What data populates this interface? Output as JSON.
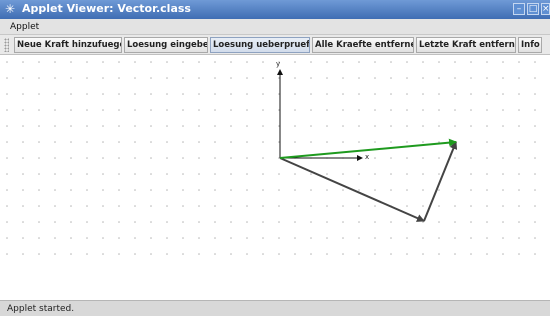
{
  "window": {
    "title": "Applet Viewer: Vector.class",
    "buttons": [
      "minimize-icon",
      "maximize-icon",
      "close-icon"
    ]
  },
  "menubar": {
    "items": [
      {
        "label": "Applet"
      }
    ]
  },
  "toolbar": {
    "buttons": [
      {
        "label": "Neue Kraft hinzufuegen"
      },
      {
        "label": "Loesung eingeben"
      },
      {
        "label": "Loesung ueberpruefen",
        "active": true
      },
      {
        "label": "Alle Kraefte entfernen"
      },
      {
        "label": "Letzte Kraft entfernen"
      },
      {
        "label": "Info"
      }
    ]
  },
  "canvas": {
    "x_axis_label": "x",
    "y_axis_label": "y",
    "colors": {
      "grid_dot": "#b5b5b5",
      "axis": "#111111",
      "force": "#444444",
      "result": "#1e9a1e"
    }
  },
  "statusbar": {
    "text": "Applet started."
  }
}
